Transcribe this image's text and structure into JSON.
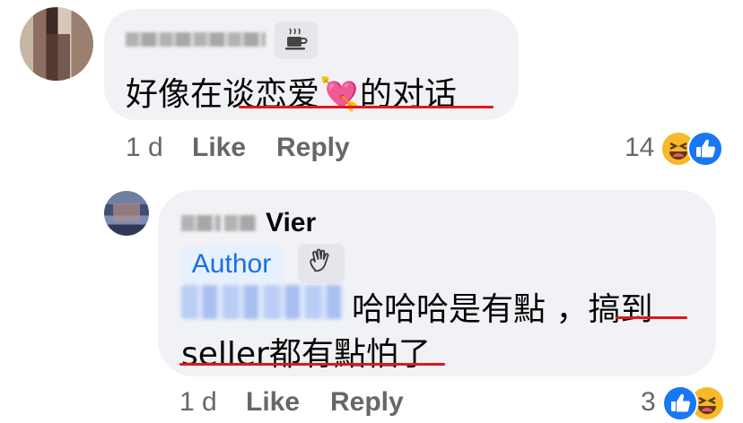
{
  "comment1": {
    "text": "好像在谈恋爱💘的对话",
    "timestamp": "1 d",
    "like_label": "Like",
    "reply_label": "Reply",
    "reaction_count": "14"
  },
  "comment2": {
    "name_suffix": "Vier",
    "author_badge": "Author",
    "text_line1": "哈哈哈是有點 ，搞到",
    "text_line2": "seller都有點怕了",
    "timestamp": "1 d",
    "like_label": "Like",
    "reply_label": "Reply",
    "reaction_count": "3"
  },
  "colors": {
    "bubble": "#f0f2f5",
    "underline": "#e0171d",
    "author_badge_text": "#1b6ee3",
    "like_blue": "#1877f2",
    "haha_yellow": "#f7b928"
  },
  "icons": {
    "comment1_badge": "coffee-cup-icon",
    "comment2_badge": "waving-hand-icon",
    "reactions": [
      "haha-reaction-icon",
      "like-reaction-icon"
    ]
  }
}
